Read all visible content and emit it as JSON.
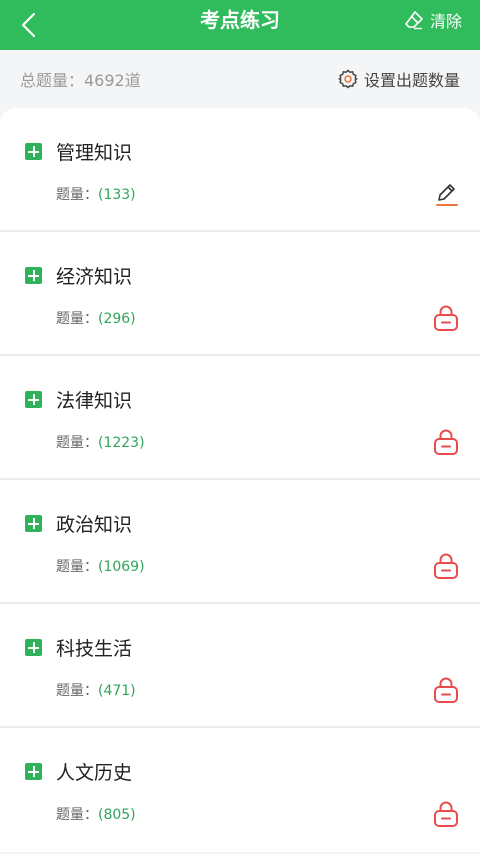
{
  "header": {
    "title": "考点练习",
    "clear_label": "清除"
  },
  "summary": {
    "total_text": "总题量：4692道",
    "settings_label": "设置出题数量"
  },
  "count_prefix": "题量：",
  "items": [
    {
      "name": "管理知识",
      "count": "(133)",
      "action_icon": "pencil-icon",
      "locked": false
    },
    {
      "name": "经济知识",
      "count": "(296)",
      "action_icon": "lock-icon",
      "locked": true
    },
    {
      "name": "法律知识",
      "count": "(1223)",
      "action_icon": "lock-icon",
      "locked": true
    },
    {
      "name": "政治知识",
      "count": "(1069)",
      "action_icon": "lock-icon",
      "locked": true
    },
    {
      "name": "科技生活",
      "count": "(471)",
      "action_icon": "lock-icon",
      "locked": true
    },
    {
      "name": "人文历史",
      "count": "(805)",
      "action_icon": "lock-icon",
      "locked": true
    }
  ],
  "colors": {
    "brand_green": "#30bb5c",
    "count_green": "#2fa65a",
    "lock_red": "#e84c4c",
    "pencil_orange": "#e8763c"
  }
}
